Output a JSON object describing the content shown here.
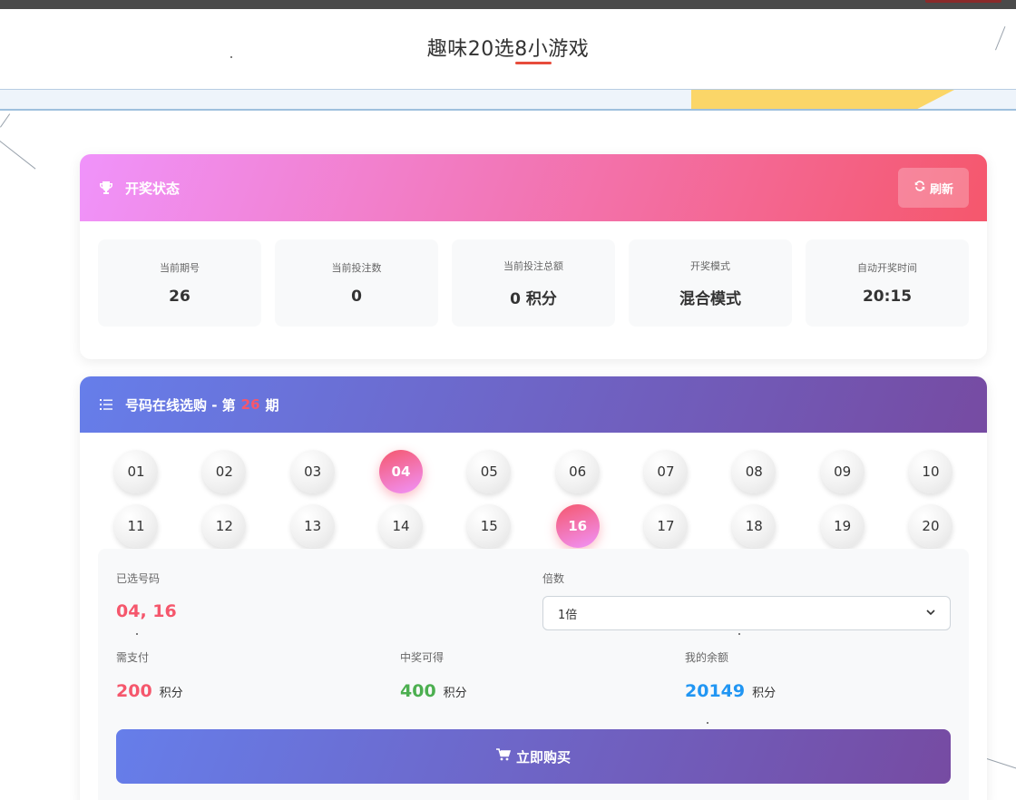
{
  "page": {
    "title": "趣味20选8小游戏"
  },
  "colors": {
    "status_gradient": [
      "#f093fb",
      "#f5576c"
    ],
    "purchase_gradient": [
      "#667eea",
      "#764ba2"
    ],
    "selected_numbers": "#f5576c",
    "win_amount": "#4caf50",
    "balance": "#2196f3"
  },
  "status_card": {
    "icon": "trophy-icon",
    "title": "开奖状态",
    "refresh_icon": "refresh-icon",
    "refresh_label": "刷新",
    "stats": [
      {
        "label": "当前期号",
        "value": "26"
      },
      {
        "label": "当前投注数",
        "value": "0"
      },
      {
        "label": "当前投注总额",
        "value": "0 积分"
      },
      {
        "label": "开奖模式",
        "value": "混合模式"
      },
      {
        "label": "自动开奖时间",
        "value": "20:15"
      }
    ]
  },
  "purchase_card": {
    "icon": "list-icon",
    "title_prefix": "号码在线选购 - 第",
    "period": "26",
    "title_suffix": "期",
    "numbers": [
      "01",
      "02",
      "03",
      "04",
      "05",
      "06",
      "07",
      "08",
      "09",
      "10",
      "11",
      "12",
      "13",
      "14",
      "15",
      "16",
      "17",
      "18",
      "19",
      "20"
    ],
    "selected": [
      "04",
      "16"
    ],
    "order": {
      "selected_label": "已选号码",
      "selected_value": "04, 16",
      "multiplier_label": "倍数",
      "multiplier_value": "1倍",
      "pay_label": "需支付",
      "pay_value": "200",
      "pay_unit": "积分",
      "win_label": "中奖可得",
      "win_value": "400",
      "win_unit": "积分",
      "balance_label": "我的余额",
      "balance_value": "20149",
      "balance_unit": "积分",
      "buy_icon": "cart-icon",
      "buy_label": "立即购买"
    }
  }
}
